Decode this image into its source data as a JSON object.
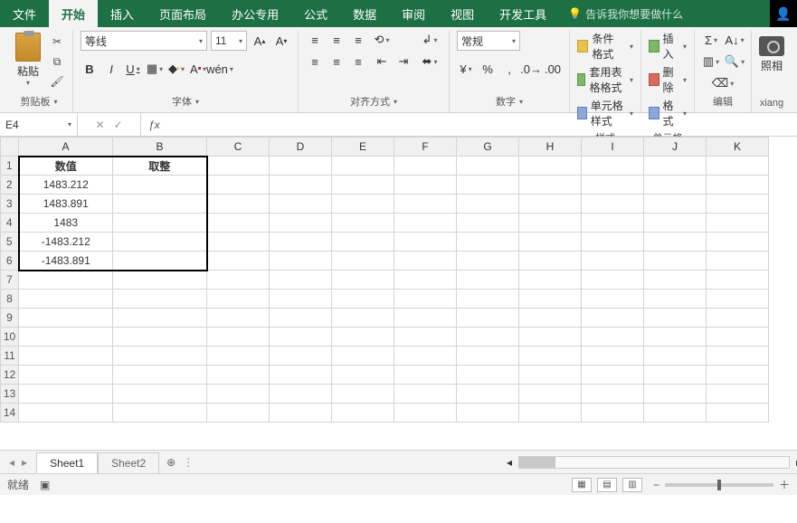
{
  "tabs": {
    "items": [
      "文件",
      "开始",
      "插入",
      "页面布局",
      "办公专用",
      "公式",
      "数据",
      "审阅",
      "视图",
      "开发工具"
    ],
    "active_index": 1,
    "tell_me": "告诉我你想要做什么"
  },
  "ribbon": {
    "clipboard": {
      "label": "剪贴板",
      "paste": "粘贴"
    },
    "font": {
      "label": "字体",
      "name": "等线",
      "size": "11",
      "bold": "B",
      "italic": "I",
      "underline": "U",
      "ruby": "wén"
    },
    "align": {
      "label": "对齐方式"
    },
    "number": {
      "label": "数字",
      "format": "常规"
    },
    "styles": {
      "label": "样式",
      "cond": "条件格式",
      "table": "套用表格格式",
      "cell": "单元格样式"
    },
    "cells": {
      "label": "单元格",
      "insert": "插入",
      "delete": "删除",
      "format": "格式"
    },
    "edit": {
      "label": "编辑"
    },
    "camera": {
      "label1": "照相",
      "label2": "xiang"
    }
  },
  "formula": {
    "cellref": "E4",
    "value": ""
  },
  "columns": [
    "A",
    "B",
    "C",
    "D",
    "E",
    "F",
    "G",
    "H",
    "I",
    "J",
    "K"
  ],
  "row_count": 14,
  "data": {
    "header": {
      "A": "数值",
      "B": "取整"
    },
    "rows": [
      {
        "A": "1483.212",
        "B": ""
      },
      {
        "A": "1483.891",
        "B": ""
      },
      {
        "A": "1483",
        "B": ""
      },
      {
        "A": "-1483.212",
        "B": ""
      },
      {
        "A": "-1483.891",
        "B": ""
      }
    ]
  },
  "sheets": {
    "tabs": [
      "Sheet1",
      "Sheet2"
    ],
    "active_index": 0
  },
  "status": {
    "ready": "就绪"
  }
}
